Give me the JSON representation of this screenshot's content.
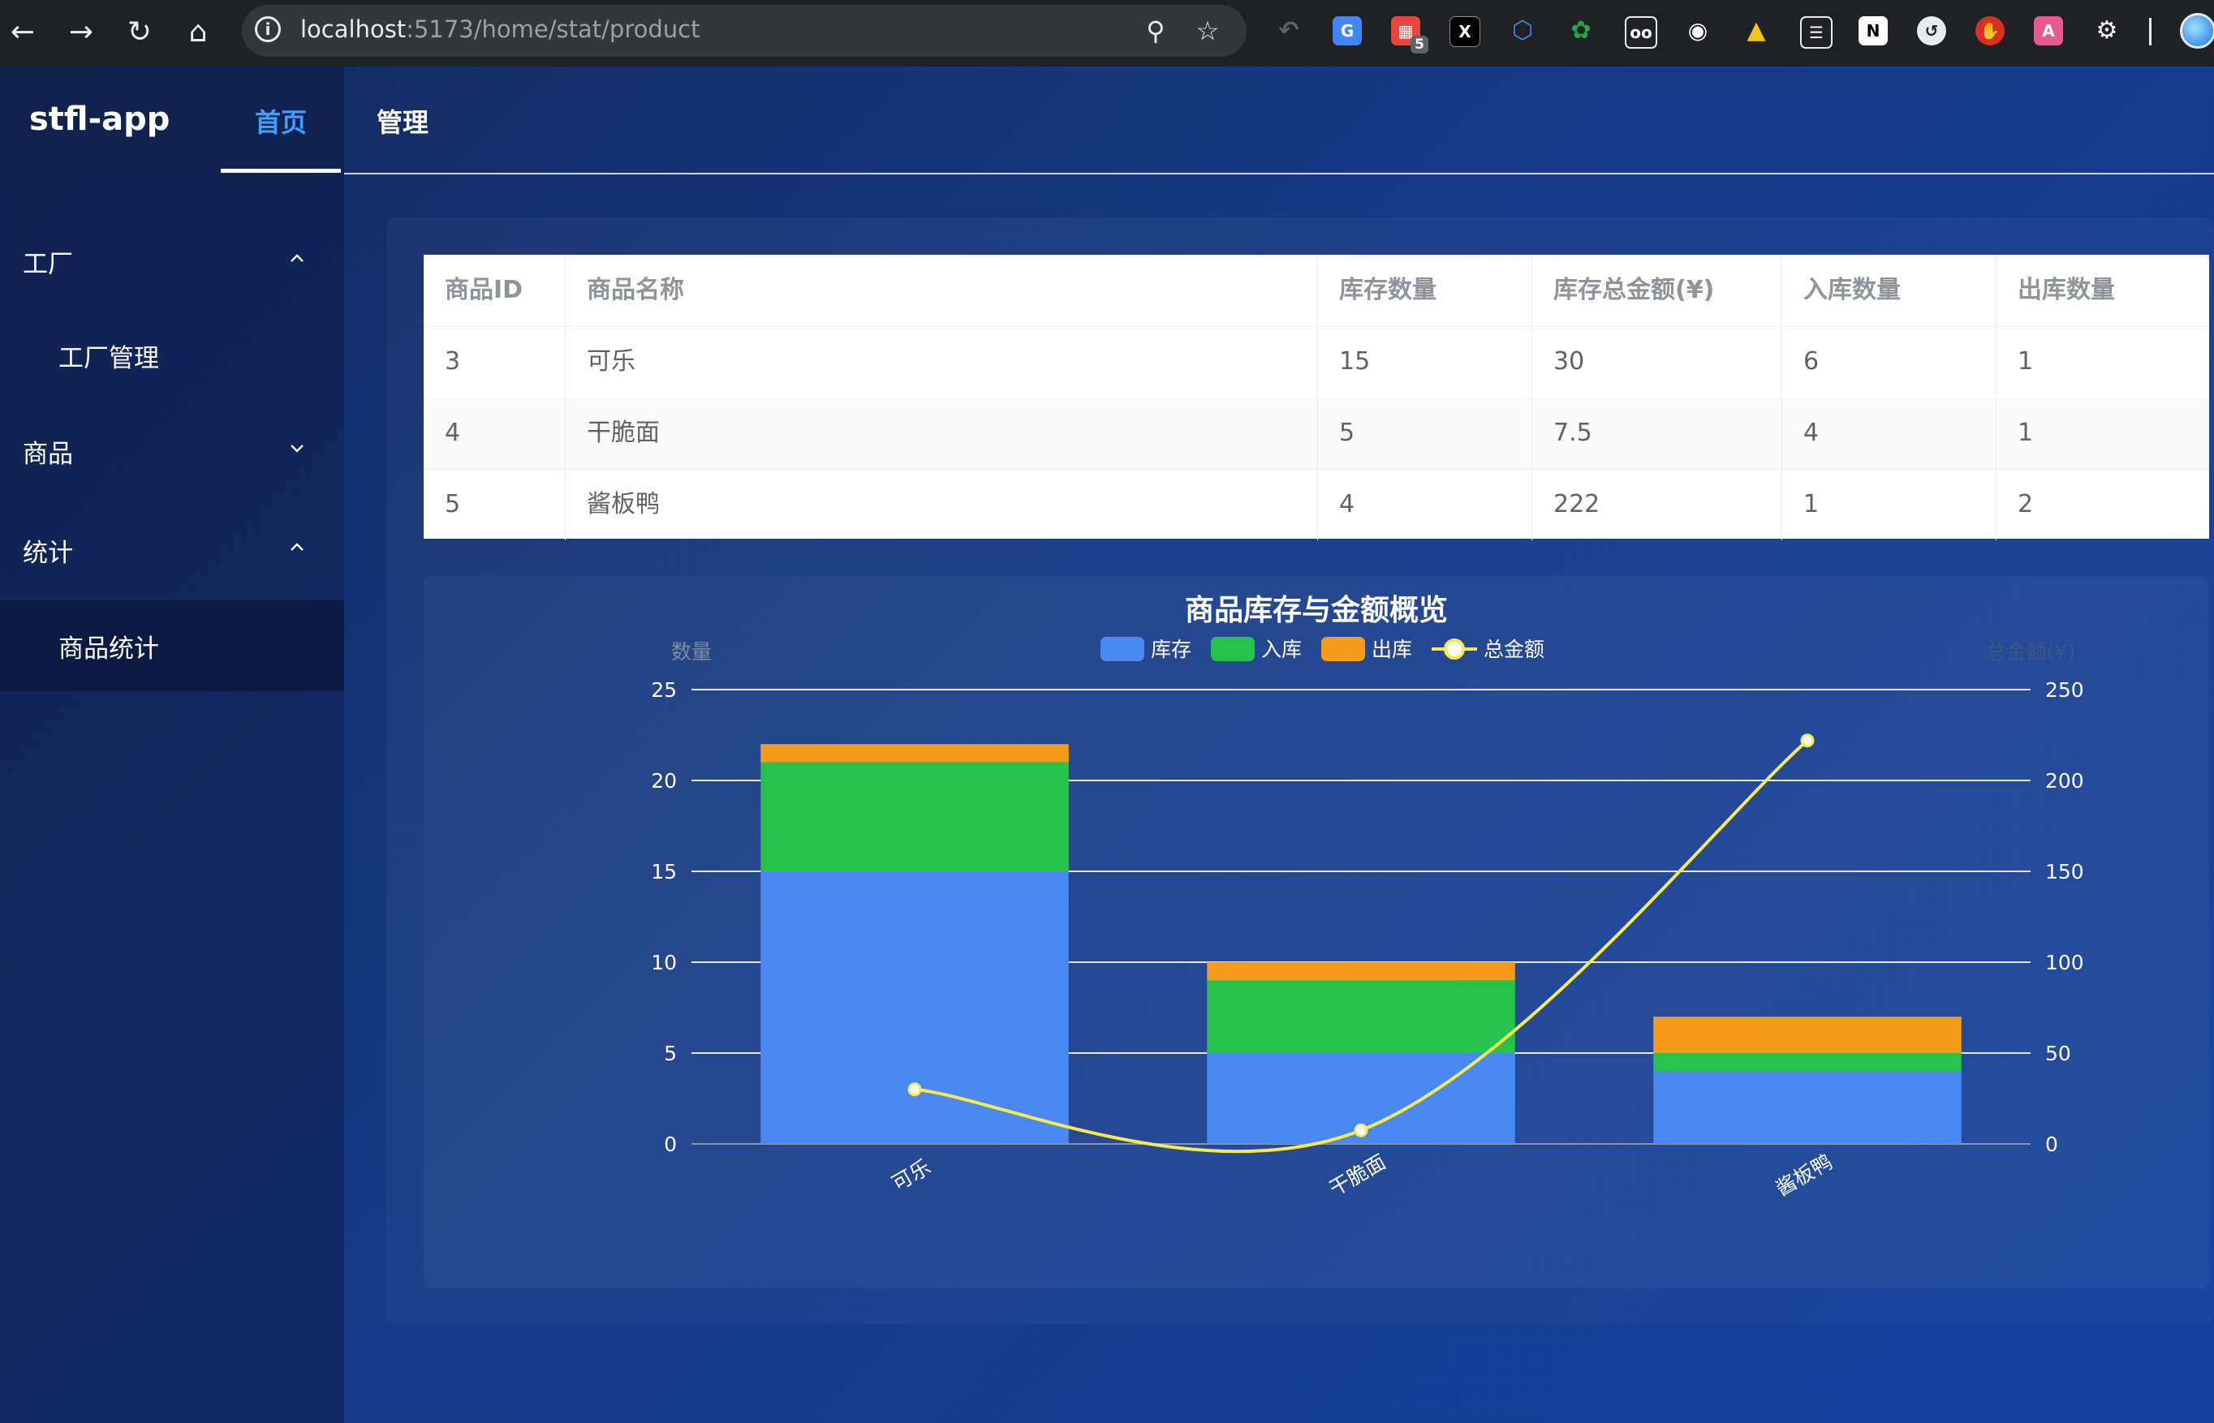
{
  "browser": {
    "url_host": "localhost",
    "url_path": ":5173/home/stat/product",
    "extension_badge": "5"
  },
  "app": {
    "brand": "stfl-app",
    "tabs": [
      {
        "label": "首页",
        "active": true
      },
      {
        "label": "管理",
        "active": false
      }
    ]
  },
  "sidebar": {
    "items": [
      {
        "label": "工厂",
        "type": "group",
        "expanded": true
      },
      {
        "label": "工厂管理",
        "type": "item"
      },
      {
        "label": "商品",
        "type": "group",
        "expanded": false
      },
      {
        "label": "统计",
        "type": "group",
        "expanded": true
      },
      {
        "label": "商品统计",
        "type": "item",
        "active": true
      }
    ]
  },
  "table": {
    "columns": [
      "商品ID",
      "商品名称",
      "库存数量",
      "库存总金额(¥)",
      "入库数量",
      "出库数量"
    ],
    "rows": [
      [
        "3",
        "可乐",
        "15",
        "30",
        "6",
        "1"
      ],
      [
        "4",
        "干脆面",
        "5",
        "7.5",
        "4",
        "1"
      ],
      [
        "5",
        "酱板鸭",
        "4",
        "222",
        "1",
        "2"
      ]
    ]
  },
  "chart_data": {
    "type": "bar",
    "title": "商品库存与金额概览",
    "categories": [
      "可乐",
      "干脆面",
      "酱板鸭"
    ],
    "stacked": true,
    "ylabel": "数量",
    "ylabel_right": "总金额(¥)",
    "ylim": [
      0,
      25
    ],
    "ylim_right": [
      0,
      250
    ],
    "yticks": [
      0,
      5,
      10,
      15,
      20,
      25
    ],
    "yticks_right": [
      0,
      50,
      100,
      150,
      200,
      250
    ],
    "grid": true,
    "legend_position": "top",
    "series": [
      {
        "name": "库存",
        "type": "bar",
        "values": [
          15,
          5,
          4
        ],
        "color": "#4a89f2"
      },
      {
        "name": "入库",
        "type": "bar",
        "values": [
          6,
          4,
          1
        ],
        "color": "#26c24b"
      },
      {
        "name": "出库",
        "type": "bar",
        "values": [
          1,
          1,
          2
        ],
        "color": "#f59b19"
      },
      {
        "name": "总金额",
        "type": "line",
        "axis": "right",
        "smooth": true,
        "values": [
          30,
          7.5,
          222
        ],
        "color": "#f7e950"
      }
    ]
  }
}
